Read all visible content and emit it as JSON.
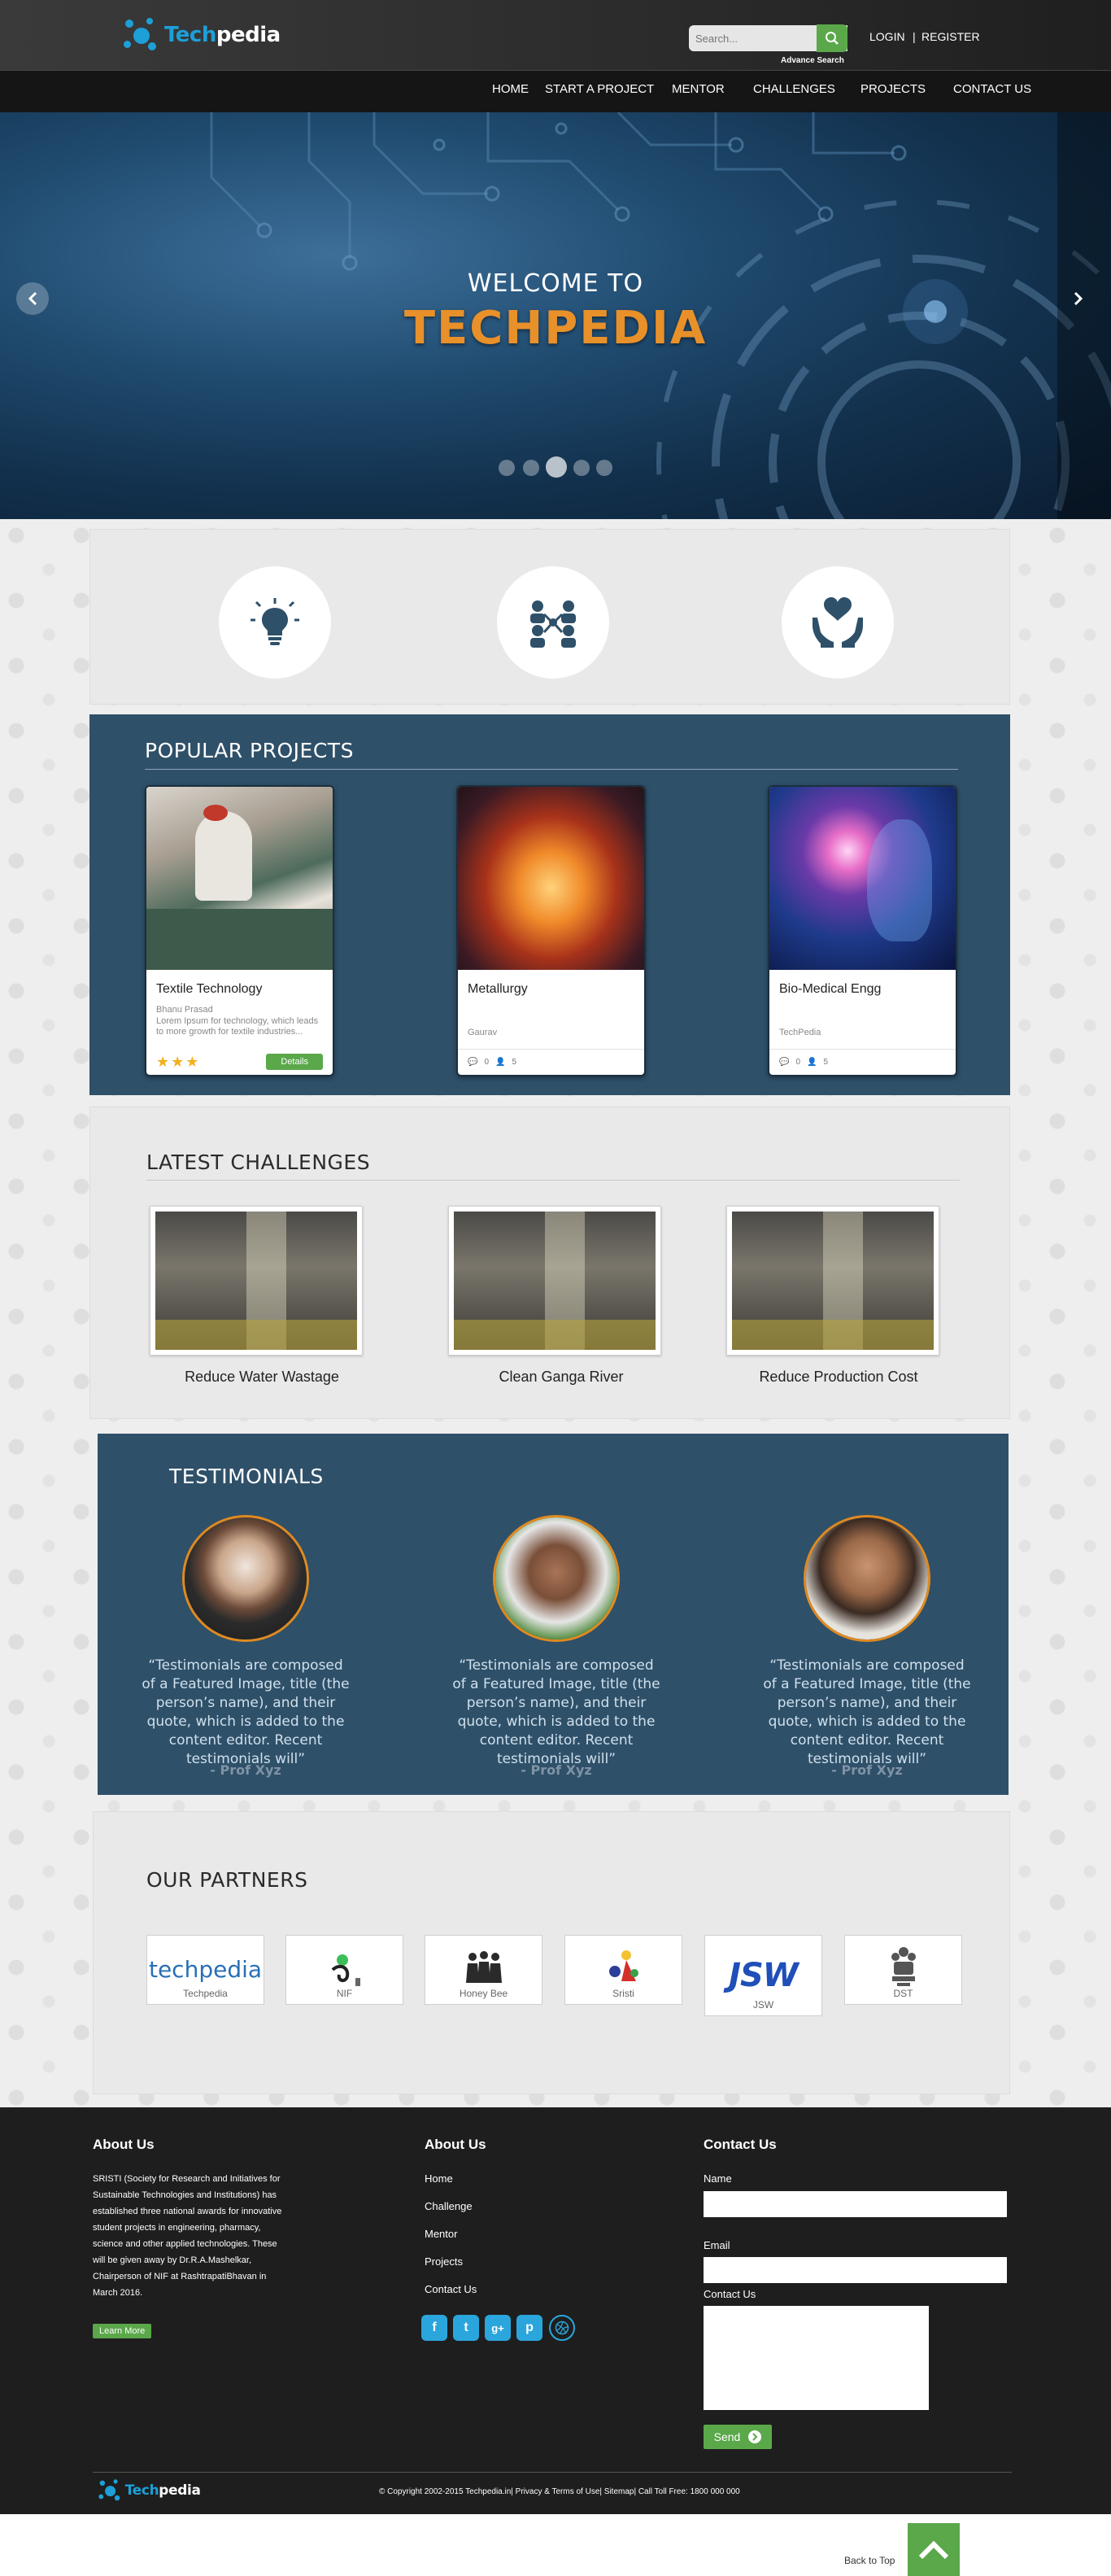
{
  "header": {
    "logo_text_a": "Te",
    "logo_text_b": "ch",
    "logo_text_c": "pedia",
    "search_placeholder": "Search...",
    "advance_search": "Advance Search",
    "login": "LOGIN",
    "separator": "|",
    "register": "REGISTER"
  },
  "nav": [
    "HOME",
    "START A PROJECT",
    "MENTOR",
    "CHALLENGES",
    "PROJECTS",
    "CONTACT US"
  ],
  "hero": {
    "welcome": "WELCOME TO",
    "title": "TECHPEDIA",
    "slide_count": 5,
    "active_slide": 3
  },
  "features": {
    "icons": [
      "lightbulb-icon",
      "team-network-icon",
      "hands-heart-icon"
    ]
  },
  "popular": {
    "title": "POPULAR PROJECTS",
    "cards": [
      {
        "title": "Textile Technology",
        "author": "Bhanu Prasad",
        "desc": "Lorem Ipsum for technology, which leads to more growth for textile industries...",
        "stars": 3,
        "button": "Details"
      },
      {
        "title": "Metallurgy",
        "author": "Gaurav",
        "comments": "0",
        "members": "5"
      },
      {
        "title": "Bio-Medical Engg",
        "author": "TechPedia",
        "comments": "0",
        "members": "5"
      }
    ]
  },
  "challenges": {
    "title": "LATEST CHALLENGES",
    "items": [
      "Reduce Water Wastage",
      "Clean Ganga River",
      "Reduce Production Cost"
    ]
  },
  "testimonials": {
    "title": "TESTIMONIALS",
    "items": [
      {
        "quote": "“Testimonials are composed of a Featured Image, title (the person’s name), and their quote, which is added to the content editor. Recent testimonials will”",
        "author": "- Prof Xyz"
      },
      {
        "quote": "“Testimonials are composed of a Featured Image, title (the person’s name), and their quote, which is added to the content editor. Recent testimonials will”",
        "author": "- Prof Xyz"
      },
      {
        "quote": "“Testimonials are composed of a Featured Image, title (the person’s name), and their quote, which is added to the content editor. Recent testimonials will”",
        "author": "- Prof Xyz"
      }
    ]
  },
  "partners": {
    "title": "OUR PARTNERS",
    "items": [
      {
        "logo": "techpedia",
        "name": "Techpedia"
      },
      {
        "logo": "",
        "name": "NIF"
      },
      {
        "logo": "",
        "name": "Honey Bee"
      },
      {
        "logo": "",
        "name": "Sristi"
      },
      {
        "logo": "JSW",
        "name": "JSW"
      },
      {
        "logo": "",
        "name": "DST"
      }
    ]
  },
  "footer": {
    "about_title": "About Us",
    "about_text": "SRISTI (Society for Research and Initiatives for Sustainable Technologies and Institutions) has established three national awards for innovative student projects in engineering, pharmacy, science and other applied technologies. These will be given away by Dr.R.A.Mashelkar, Chairperson of NIF at RashtrapatiBhavan in March 2016.",
    "learn_more": "Learn More",
    "links_title": "About Us",
    "links": [
      "Home",
      "Challenge",
      "Mentor",
      "Projects",
      "Contact Us"
    ],
    "contact_title": "Contact Us",
    "name_label": "Name",
    "email_label": "Email",
    "message_label": "Contact Us",
    "send": "Send",
    "copyright": "© Copyright 2002-2015 Techpedia.in| Privacy & Terms of Use| Sitemap| Call Toll Free: 1800 000 000",
    "back_to_top": "Back to Top"
  },
  "colors": {
    "accent_green": "#5aa84a",
    "brand_blue": "#1d9fd8",
    "dark_panel": "#2f5069",
    "hero_orange": "#e8902a"
  }
}
